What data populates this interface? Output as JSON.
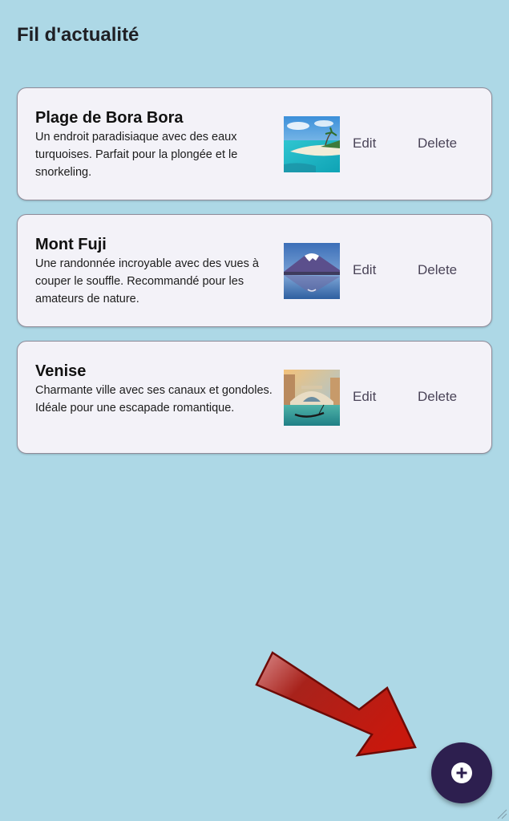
{
  "header": {
    "title": "Fil d'actualité"
  },
  "posts": [
    {
      "title": "Plage de Bora Bora",
      "description": "Un endroit paradisiaque avec des eaux turquoises. Parfait pour la plongée et le snorkeling.",
      "image_icon": "beach-photo",
      "edit_label": "Edit",
      "delete_label": "Delete"
    },
    {
      "title": "Mont Fuji",
      "description": "Une randonnée incroyable avec des vues à couper le souffle. Recommandé pour les amateurs de nature.",
      "image_icon": "mountain-photo",
      "edit_label": "Edit",
      "delete_label": "Delete"
    },
    {
      "title": "Venise",
      "description": "Charmante ville avec ses canaux et gondoles. Idéale pour une escapade romantique.",
      "image_icon": "venice-photo",
      "edit_label": "Edit",
      "delete_label": "Delete"
    }
  ],
  "fab": {
    "icon": "plus-icon",
    "color": "#2d1f4f"
  },
  "annotation": {
    "icon": "arrow-icon",
    "color": "#c0150c"
  },
  "theme": {
    "background": "#add8e6",
    "card_background": "#f3f2f8",
    "button_text": "#4a4458"
  }
}
